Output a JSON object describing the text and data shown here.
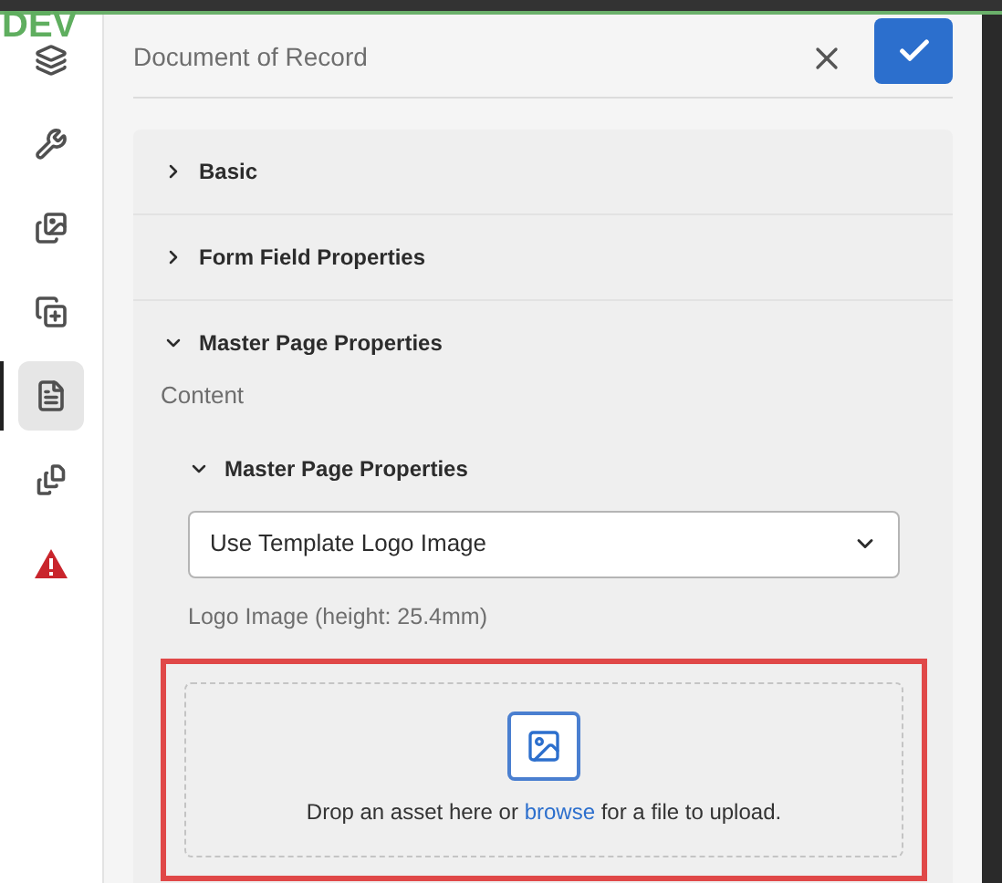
{
  "env_badge": "DEV",
  "sidebar": {
    "items": [
      {
        "selected": false
      },
      {
        "selected": false
      },
      {
        "selected": false
      },
      {
        "selected": false
      },
      {
        "selected": true
      },
      {
        "selected": false
      },
      {
        "selected": false
      }
    ]
  },
  "panel": {
    "title": "Document of Record",
    "sections": [
      {
        "label": "Basic",
        "expanded": false
      },
      {
        "label": "Form Field Properties",
        "expanded": false
      },
      {
        "label": "Master Page Properties",
        "expanded": true,
        "content_label": "Content",
        "subsection": {
          "label": "Master Page Properties",
          "expanded": true,
          "dropdown": {
            "value": "Use Template Logo Image"
          },
          "logo_label": "Logo Image (height: 25.4mm)",
          "dropzone": {
            "text_before": "Drop an asset here or",
            "link": "browse",
            "text_after": "for a file to upload.",
            "highlighted": true
          }
        }
      }
    ]
  }
}
